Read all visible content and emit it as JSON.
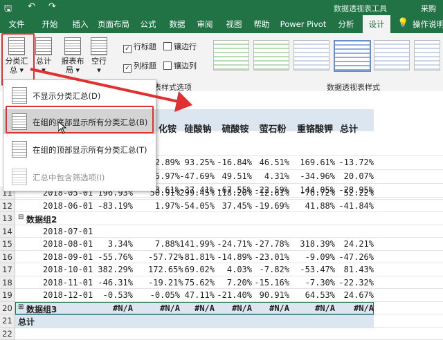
{
  "titlebar": {
    "context_label": "数据透视表工具",
    "user_label": "采购数"
  },
  "tabs": [
    "文件",
    "开始",
    "插入",
    "页面布局",
    "公式",
    "数据",
    "审阅",
    "视图",
    "帮助",
    "Power Pivot",
    "分析",
    "设计"
  ],
  "tell_me": "操作说明",
  "ribbon": {
    "subtotal": "分类汇总",
    "grand_total": "总计",
    "report_layout": "报表布局",
    "blank_rows": "空行",
    "chk_row_headers": "行标题",
    "chk_banded_rows": "镶边行",
    "chk_col_headers": "列标题",
    "chk_banded_cols": "镶边列",
    "group_style_options": "表样式选项",
    "group_styles": "数据透视表样式"
  },
  "menu": {
    "items": [
      {
        "label": "不显示分类汇总(D)"
      },
      {
        "label": "在组的底部显示所有分类汇总(B)"
      },
      {
        "label": "在组的顶部显示所有分类汇总(T)"
      },
      {
        "label": "汇总中包含筛选项(I)"
      }
    ]
  },
  "sheet": {
    "headers": [
      "化铵",
      "硅酸钠",
      "硫酸铵",
      "萤石粉",
      "重铬酸钾",
      "总计"
    ],
    "rows": [
      {
        "n": "",
        "label": "",
        "vals": [
          "",
          "",
          "",
          "",
          "",
          ""
        ]
      },
      {
        "n": "",
        "label": "",
        "vals": [
          "2.89%",
          "93.25%",
          "-16.84%",
          "46.51%",
          "169.61%",
          "-13.72%"
        ]
      },
      {
        "n": "",
        "label": "",
        "vals": [
          "5.97%",
          "-47.69%",
          "49.51%",
          "4.31%",
          "-34.96%",
          "20.07%"
        ]
      },
      {
        "n": "",
        "label": "",
        "vals": [
          "8.61%",
          "-37.41%",
          "-67.55%",
          "-22.59%",
          "144.05%",
          "-28.95%"
        ]
      },
      {
        "n": "11",
        "label": "2018-05-01",
        "first": "196.93%",
        "vals": [
          "50.91%",
          "299.45%",
          "118.20%",
          "-12.61%",
          "-76.72%",
          "52.22%"
        ]
      },
      {
        "n": "12",
        "label": "2018-06-01",
        "first": "-83.19%",
        "vals": [
          "1.97%",
          "-54.05%",
          "37.45%",
          "-19.69%",
          "41.88%",
          "-41.84%"
        ]
      },
      {
        "n": "13",
        "group": "数据组2"
      },
      {
        "n": "14",
        "label": "2018-07-01",
        "first": "",
        "vals": [
          "",
          "",
          "",
          "",
          "",
          ""
        ]
      },
      {
        "n": "15",
        "label": "2018-08-01",
        "first": "3.34%",
        "vals": [
          "7.88%",
          "141.99%",
          "-24.71%",
          "-27.78%",
          "318.39%",
          "24.21%"
        ]
      },
      {
        "n": "16",
        "label": "2018-09-01",
        "first": "-55.76%",
        "vals": [
          "-57.72%",
          "-81.81%",
          "-14.89%",
          "-23.01%",
          "-9.09%",
          "-47.26%"
        ]
      },
      {
        "n": "17",
        "label": "2018-10-01",
        "first": "382.29%",
        "vals": [
          "172.65%",
          "69.02%",
          "4.03%",
          "-7.82%",
          "-53.47%",
          "81.43%"
        ]
      },
      {
        "n": "18",
        "label": "2018-11-01",
        "first": "-46.31%",
        "vals": [
          "-19.21%",
          "75.62%",
          "7.20%",
          "-15.16%",
          "-7.30%",
          "-22.32%"
        ]
      },
      {
        "n": "19",
        "label": "2018-12-01",
        "first": "-0.53%",
        "vals": [
          "-0.05%",
          "47.11%",
          "-21.40%",
          "90.91%",
          "64.53%",
          "24.67%"
        ]
      },
      {
        "n": "20",
        "group3": "数据组3",
        "first": "#N/A",
        "vals": [
          "#N/A",
          "#N/A",
          "#N/A",
          "#N/A",
          "#N/A",
          "#N/A"
        ]
      },
      {
        "n": "21",
        "total": "总计"
      },
      {
        "n": "22"
      }
    ]
  }
}
